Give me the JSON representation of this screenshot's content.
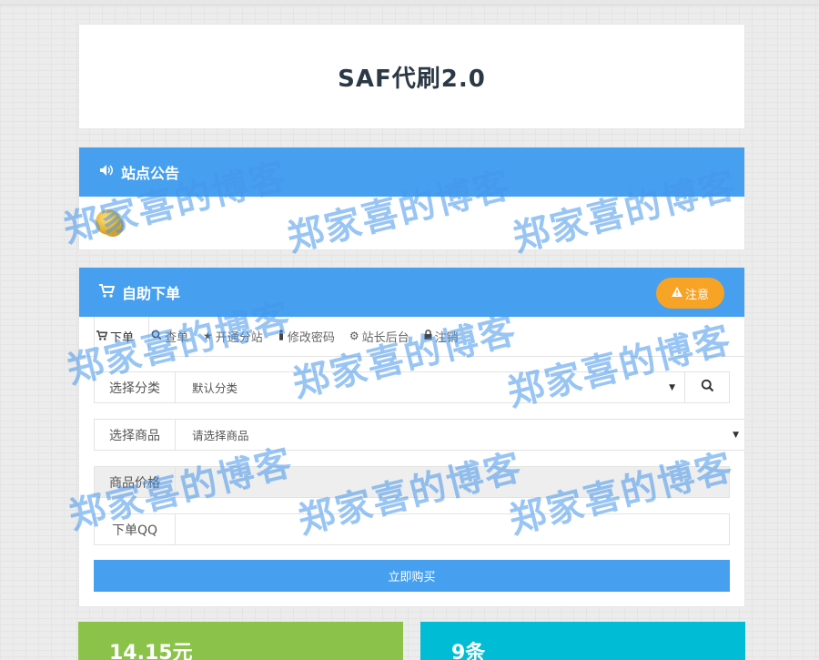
{
  "site": {
    "title": "SAF代刷2.0"
  },
  "notice": {
    "heading": "站点公告"
  },
  "order": {
    "heading": "自助下单",
    "notice_button": "注意",
    "tabs": [
      {
        "label": "下单",
        "icon": "cart-icon"
      },
      {
        "label": "查单",
        "icon": "search-icon"
      },
      {
        "label": "开通分站",
        "icon": "star-icon"
      },
      {
        "label": "修改密码",
        "icon": "person-icon"
      },
      {
        "label": "站长后台",
        "icon": "gear-icon"
      },
      {
        "label": "注销",
        "icon": "lock-icon"
      }
    ],
    "category": {
      "label": "选择分类",
      "value": "默认分类"
    },
    "product": {
      "label": "选择商品",
      "value": "请选择商品"
    },
    "price": {
      "label": "商品价格",
      "value": ""
    },
    "qq": {
      "label": "下单QQ",
      "value": ""
    },
    "buy_button": "立即购买"
  },
  "stats": {
    "amount": "14.15元",
    "count": "9条"
  },
  "watermark": "郑家喜的博客",
  "colors": {
    "primary": "#46a0ef",
    "warning": "#f7a326",
    "green": "#8bc34a",
    "cyan": "#00bcd4"
  }
}
